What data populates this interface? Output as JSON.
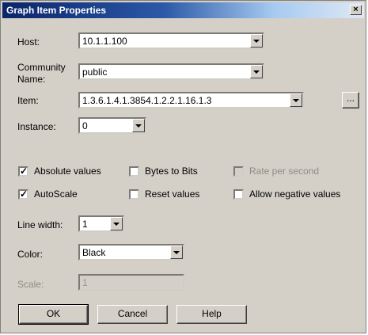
{
  "window": {
    "title": "Graph Item Properties",
    "close_glyph": "×"
  },
  "host": {
    "label": "Host:",
    "value": "10.1.1.100"
  },
  "community": {
    "label_line1": "Community",
    "label_line2": "Name:",
    "value": "public"
  },
  "item": {
    "label": "Item:",
    "value": "1.3.6.1.4.1.3854.1.2.2.1.16.1.3",
    "browse_label": "..."
  },
  "instance": {
    "label": "Instance:",
    "value": "0"
  },
  "checkboxes": {
    "absolute_values": {
      "label": "Absolute values",
      "checked": true
    },
    "bytes_to_bits": {
      "label": "Bytes to Bits",
      "checked": false
    },
    "rate_per_second": {
      "label": "Rate per second",
      "checked": false,
      "disabled": true
    },
    "autoscale": {
      "label": "AutoScale",
      "checked": true
    },
    "reset_values": {
      "label": "Reset values",
      "checked": false
    },
    "allow_negative": {
      "label": "Allow negative values",
      "checked": false
    }
  },
  "check_glyph": "✓",
  "line_width": {
    "label": "Line width:",
    "value": "1"
  },
  "color": {
    "label": "Color:",
    "value": "Black"
  },
  "scale": {
    "label": "Scale:",
    "value": "1",
    "disabled": true
  },
  "buttons": {
    "ok": "OK",
    "cancel": "Cancel",
    "help": "Help"
  }
}
